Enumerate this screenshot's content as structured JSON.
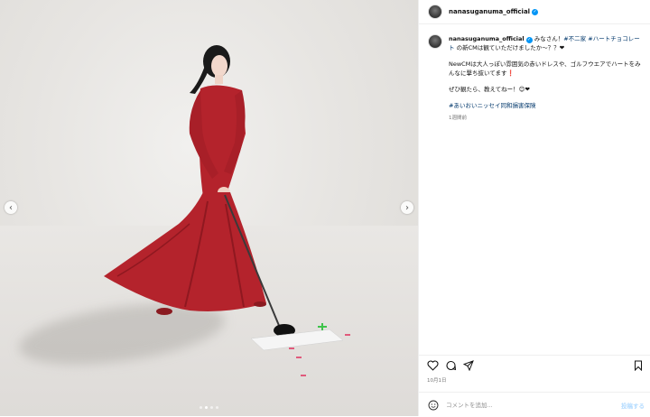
{
  "post": {
    "image_alt": "Woman in a red dress holding a golf driver"
  },
  "header": {
    "username": "nanasuganuma_official",
    "verified_icon": "verified-badge-icon"
  },
  "caption": {
    "username": "nanasuganuma_official",
    "line1_text": " みなさん！",
    "hashtag1": "#不二家",
    "hashtag2": "#ハートチョコレート",
    "line1_rest": " の新CMは観ていただけましたか〜？？❤",
    "paragraph2": "NewCMは大人っぽい雰囲気の赤いドレスや、ゴルフウエアでハートをみんなに撃ち抜いてます❗",
    "paragraph3": "ぜひ観たら、教えてねー！😊❤",
    "hashtag3": "#あいおいニッセイ同和損害保険",
    "time_ago": "1週間前"
  },
  "actions": {
    "date": "10月1日"
  },
  "comment": {
    "placeholder": "コメントを追加...",
    "post_label": "投稿する"
  },
  "colors": {
    "dress": "#b4232c",
    "verified": "#0095f6",
    "hashtag": "#00376b"
  },
  "carousel": {
    "current_slide": 2,
    "total_slides": 4
  }
}
